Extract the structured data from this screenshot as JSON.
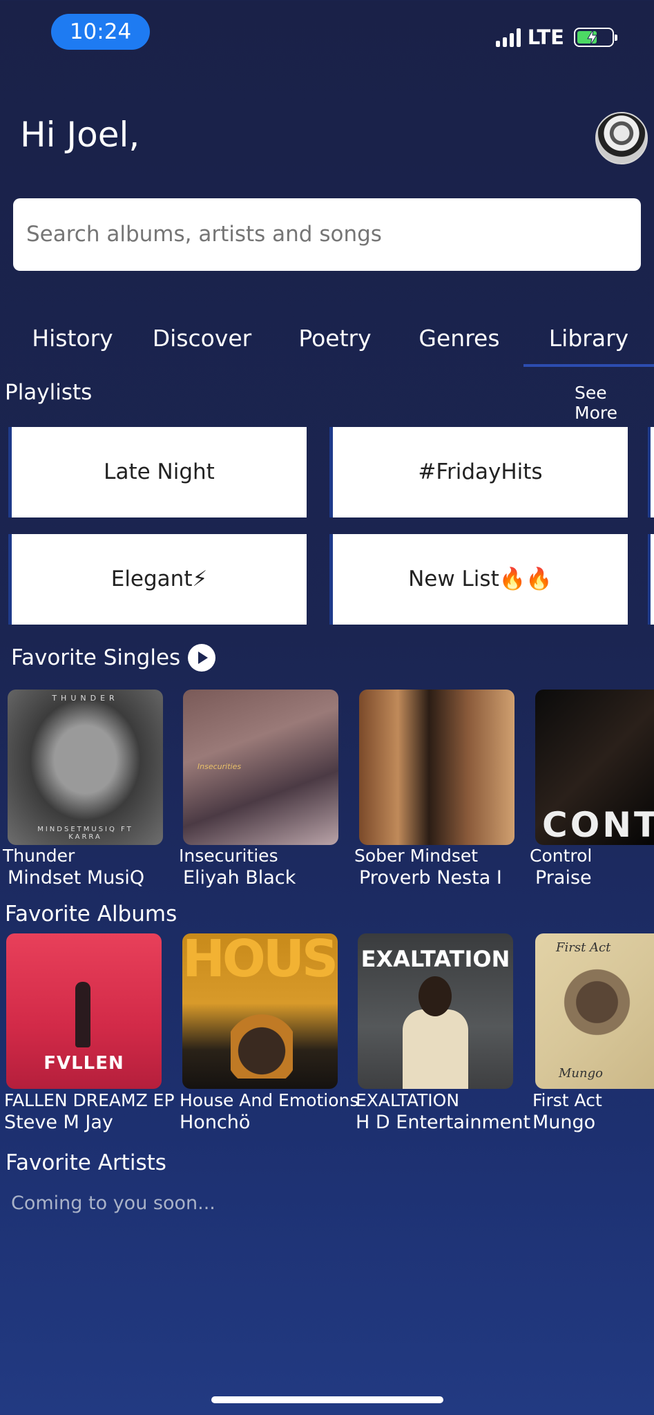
{
  "status": {
    "time": "10:24",
    "network": "LTE"
  },
  "greeting": "Hi Joel,",
  "search": {
    "placeholder": "Search albums, artists and songs"
  },
  "tabs": [
    {
      "label": "History"
    },
    {
      "label": "Discover"
    },
    {
      "label": "Poetry"
    },
    {
      "label": "Genres"
    },
    {
      "label": "Library",
      "active": true
    }
  ],
  "playlists": {
    "title": "Playlists",
    "see_more": "See More",
    "items": [
      "Late Night",
      "#FridayHits",
      "Elegant⚡",
      "New List🔥🔥"
    ]
  },
  "singles": {
    "title": "Favorite Singles",
    "items": [
      {
        "title": "Thunder",
        "artist": "Mindset MusiQ",
        "cover_top": "THUNDER",
        "cover_bottom": "MINDSETMUSIQ FT KARRA"
      },
      {
        "title": "Insecurities",
        "artist": "Eliyah Black",
        "cover_text": "Insecurities"
      },
      {
        "title": "Sober Mindset",
        "artist": "Proverb Nesta I"
      },
      {
        "title": "Control",
        "artist": "Praise",
        "cover_text": "CONTRO"
      }
    ]
  },
  "albums": {
    "title": "Favorite Albums",
    "items": [
      {
        "title": "FALLEN DREAMZ EP",
        "artist": "Steve M Jay",
        "cover_text": "FVLLEN"
      },
      {
        "title": "House And Emotions",
        "artist": "Honchö",
        "cover_text": "HOUSE"
      },
      {
        "title": "EXALTATION",
        "artist": "H D Entertainment",
        "cover_text": "EXALTATION"
      },
      {
        "title": "First Act",
        "artist": "Mungo",
        "cover_top": "First Act",
        "cover_bottom": "Mungo"
      }
    ]
  },
  "artists": {
    "title": "Favorite Artists",
    "empty_text": "Coming to you soon..."
  },
  "colors": {
    "background": "#1b2552",
    "accent": "#1e7bf2",
    "tab_underline": "#2c4cb0"
  }
}
